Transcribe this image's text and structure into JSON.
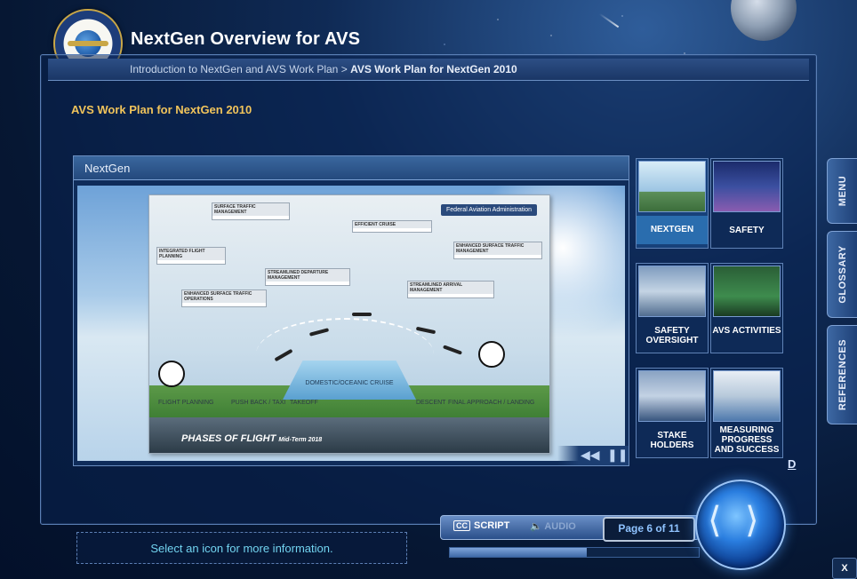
{
  "app": {
    "title": "NextGen Overview for AVS",
    "logo_text": "FEDERAL AVIATION ADMINISTRATION"
  },
  "breadcrumb": {
    "parent": "Introduction to NextGen and AVS Work Plan",
    "separator": ">",
    "current": "AVS Work Plan for NextGen 2010"
  },
  "page": {
    "heading": "AVS Work Plan for NextGen 2010"
  },
  "viewer": {
    "title": "NextGen",
    "poster": {
      "org": "Federal Aviation Administration",
      "footer": "PHASES OF FLIGHT",
      "footer_sub": "Mid-Term 2018",
      "phases": [
        "FLIGHT PLANNING",
        "PUSH BACK / TAXI",
        "TAKEOFF",
        "DOMESTIC/OCEANIC CRUISE",
        "DESCENT",
        "FINAL APPROACH / LANDING"
      ],
      "boxes": [
        "SURFACE TRAFFIC MANAGEMENT",
        "INTEGRATED FLIGHT PLANNING",
        "ENHANCED SURFACE TRAFFIC OPERATIONS",
        "STREAMLINED DEPARTURE MANAGEMENT",
        "EFFICIENT CRUISE",
        "STREAMLINED ARRIVAL MANAGEMENT",
        "ENHANCED SURFACE TRAFFIC MANAGEMENT"
      ]
    },
    "controls": {
      "rewind_icon": "rewind-icon",
      "pause_icon": "pause-icon"
    }
  },
  "tiles": [
    {
      "label": "NEXTGEN",
      "active": true
    },
    {
      "label": "SAFETY",
      "active": false
    },
    {
      "label": "SAFETY OVERSIGHT",
      "active": false
    },
    {
      "label": "AVS ACTIVITIES",
      "active": false
    },
    {
      "label": "STAKE HOLDERS",
      "active": false
    },
    {
      "label": "MEASURING PROGRESS AND SUCCESS",
      "active": false
    }
  ],
  "d_link": "D",
  "side_tabs": [
    "MENU",
    "GLOSSARY",
    "REFERENCES"
  ],
  "status": {
    "message": "Select an icon for more information."
  },
  "media": {
    "script_label": "SCRIPT",
    "script_icon": "CC",
    "audio_label": "AUDIO"
  },
  "pagination": {
    "text": "Page 6 of 11",
    "current": 6,
    "total": 11,
    "progress": 0.55
  },
  "close_label": "X"
}
